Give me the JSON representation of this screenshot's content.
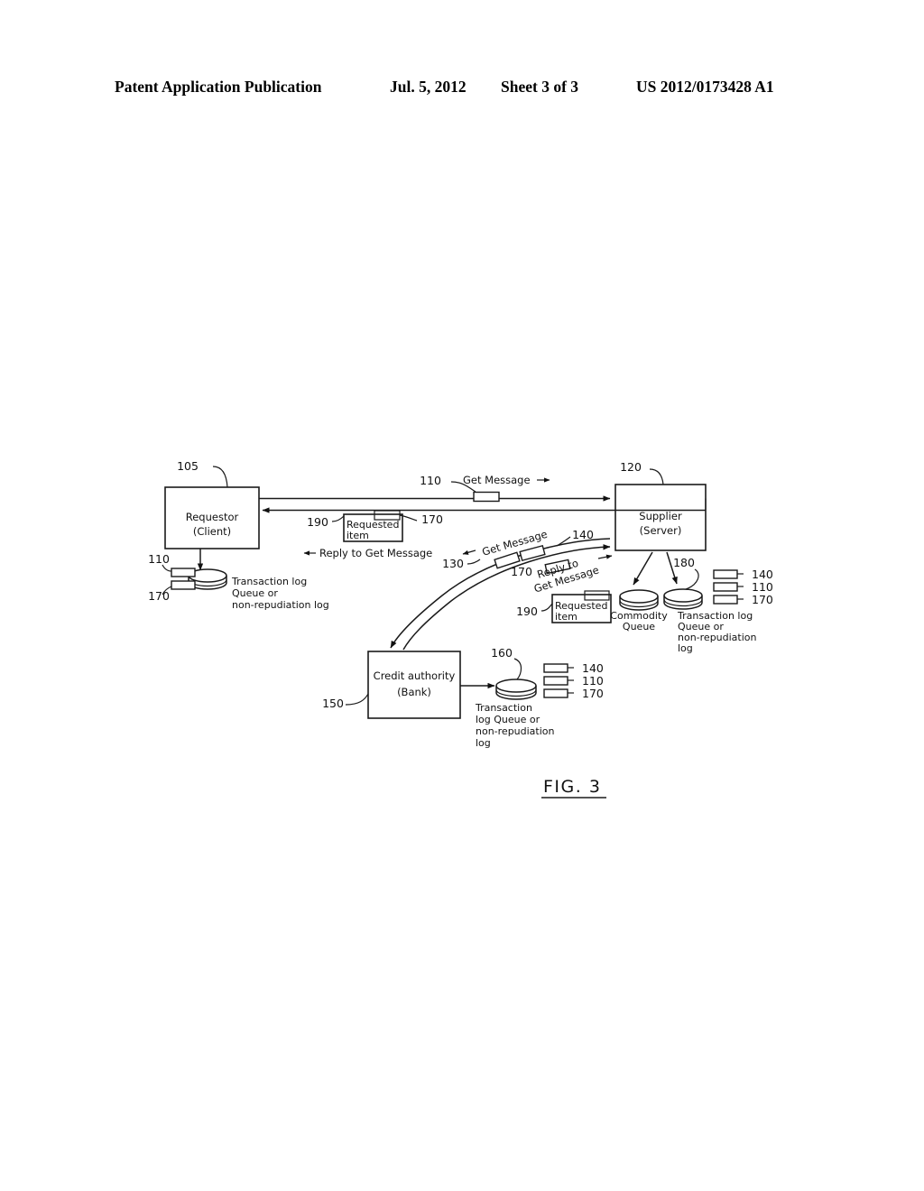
{
  "header": {
    "publication": "Patent Application Publication",
    "date": "Jul. 5, 2012",
    "sheet": "Sheet 3 of 3",
    "patent_number": "US 2012/0173428 A1"
  },
  "figure": {
    "caption": "FIG. 3",
    "boxes": {
      "requestor": {
        "line1": "Requestor",
        "line2": "(Client)",
        "ref": "105"
      },
      "supplier": {
        "line1": "Supplier",
        "line2": "(Server)",
        "ref": "120"
      },
      "credit_authority": {
        "line1": "Credit authority",
        "line2": "(Bank)",
        "ref": "150"
      },
      "requested_item_left": {
        "line1": "Requested",
        "line2": "item",
        "ref": "190",
        "tag": "170"
      },
      "requested_item_right": {
        "line1": "Requested",
        "line2": "item",
        "ref": "190"
      }
    },
    "flow_labels": {
      "get_message_top": "Get Message",
      "get_message_top_ref": "110",
      "get_message_top_tag": "170",
      "reply_to_get_message_left": "Reply to Get Message",
      "get_message_curve": "Get Message",
      "get_message_curve_ref": "130",
      "get_message_curve_tag_140": "140",
      "get_message_curve_tag_170": "170",
      "reply_to_get_message_curve_line1": "Reply to",
      "reply_to_get_message_curve_line2": "Get Message"
    },
    "stores": {
      "requestor_log": {
        "line1": "Transaction log",
        "line2": "Queue  or",
        "line3": "non-repudiation log",
        "tags": [
          "110",
          "170"
        ]
      },
      "commodity_queue": {
        "line1": "Commodity",
        "line2": "Queue"
      },
      "supplier_log": {
        "line1": "Transaction log",
        "line2": "Queue or",
        "line3": "non-repudiation",
        "line4": "log",
        "ref": "180",
        "tags": [
          "140",
          "110",
          "170"
        ]
      },
      "bank_log": {
        "line1": "Transaction",
        "line2": "log Queue or",
        "line3": "non-repudiation",
        "line4": "log",
        "ref": "160",
        "tags": [
          "140",
          "110",
          "170"
        ]
      }
    }
  }
}
